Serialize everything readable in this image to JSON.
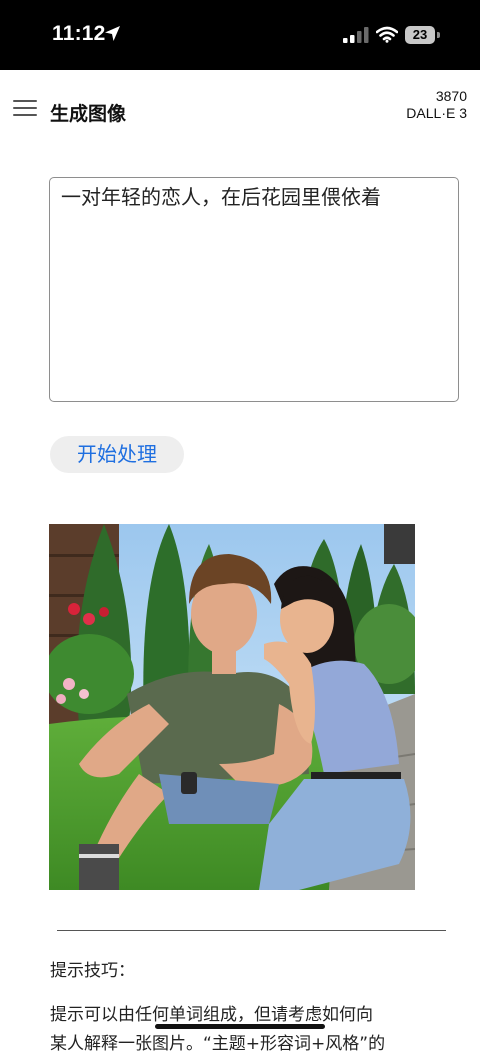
{
  "status_bar": {
    "time": "11:12",
    "battery": "23"
  },
  "header": {
    "title": "生成图像",
    "credits": "3870",
    "model": "DALL·E 3"
  },
  "prompt": {
    "value": "一对年轻的恋人，在后花园里偎依着"
  },
  "actions": {
    "start_label": "开始处理"
  },
  "tips": {
    "heading": "提示技巧：",
    "line1": "提示可以由任何单词组成，但请考虑如何向",
    "line2": "某人解释一张图片。“主题+形容词+风格”的"
  },
  "colors": {
    "accent": "#1f6fe0",
    "button_bg": "#eeeeee"
  }
}
